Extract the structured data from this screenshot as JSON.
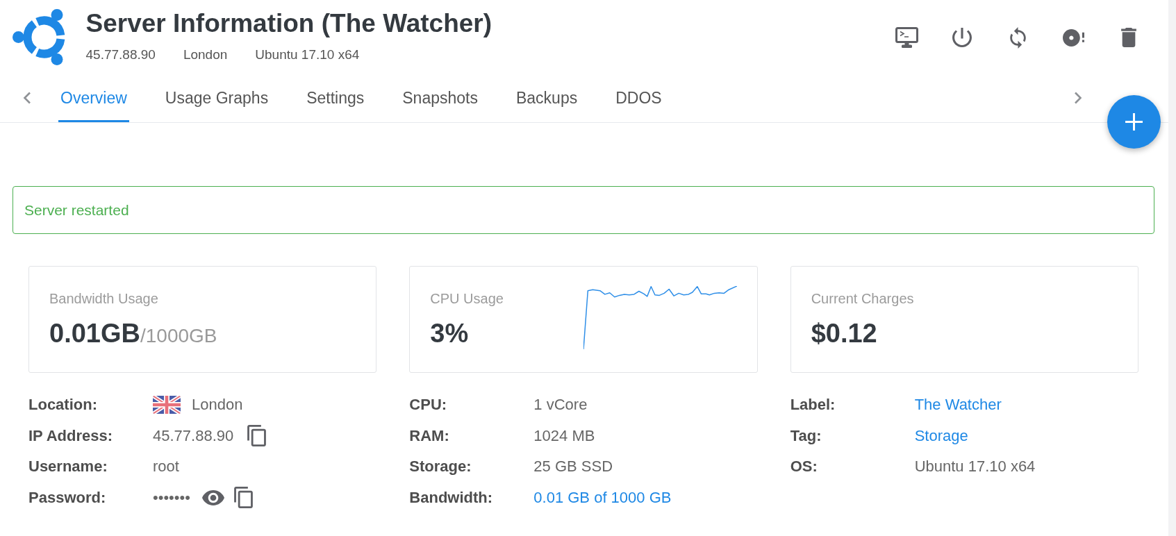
{
  "header": {
    "title": "Server Information (The Watcher)",
    "meta": [
      "45.77.88.90",
      "London",
      "Ubuntu 17.10 x64"
    ]
  },
  "tabs": [
    {
      "label": "Overview",
      "selected": true
    },
    {
      "label": "Usage Graphs",
      "selected": false
    },
    {
      "label": "Settings",
      "selected": false
    },
    {
      "label": "Snapshots",
      "selected": false
    },
    {
      "label": "Backups",
      "selected": false
    },
    {
      "label": "DDOS",
      "selected": false
    }
  ],
  "alert": {
    "message": "Server restarted"
  },
  "cards": [
    {
      "kind": "text",
      "label": "Bandwidth Usage",
      "value": "0.01GB",
      "suffix": "/1000GB"
    },
    {
      "kind": "sparkline",
      "label": "CPU Usage",
      "value": "3%"
    },
    {
      "kind": "text",
      "label": "Current Charges",
      "value": "$0.12"
    }
  ],
  "details": [
    [
      {
        "kind": "flag",
        "label": "Location:",
        "value": "London"
      },
      {
        "kind": "copy",
        "label": "IP Address:",
        "value": "45.77.88.90"
      },
      {
        "kind": "text",
        "label": "Username:",
        "value": "root"
      },
      {
        "kind": "secret",
        "label": "Password:",
        "value": "•••••••"
      }
    ],
    [
      {
        "kind": "text",
        "label": "CPU:",
        "value": "1 vCore"
      },
      {
        "kind": "text",
        "label": "RAM:",
        "value": "1024 MB"
      },
      {
        "kind": "text",
        "label": "Storage:",
        "value": "25 GB SSD"
      },
      {
        "kind": "link",
        "label": "Bandwidth:",
        "value": "0.01 GB of 1000 GB"
      }
    ],
    [
      {
        "kind": "link",
        "label": "Label:",
        "value": "The Watcher"
      },
      {
        "kind": "link",
        "label": "Tag:",
        "value": "Storage"
      },
      {
        "kind": "text",
        "label": "OS:",
        "value": "Ubuntu 17.10 x64"
      }
    ]
  ]
}
